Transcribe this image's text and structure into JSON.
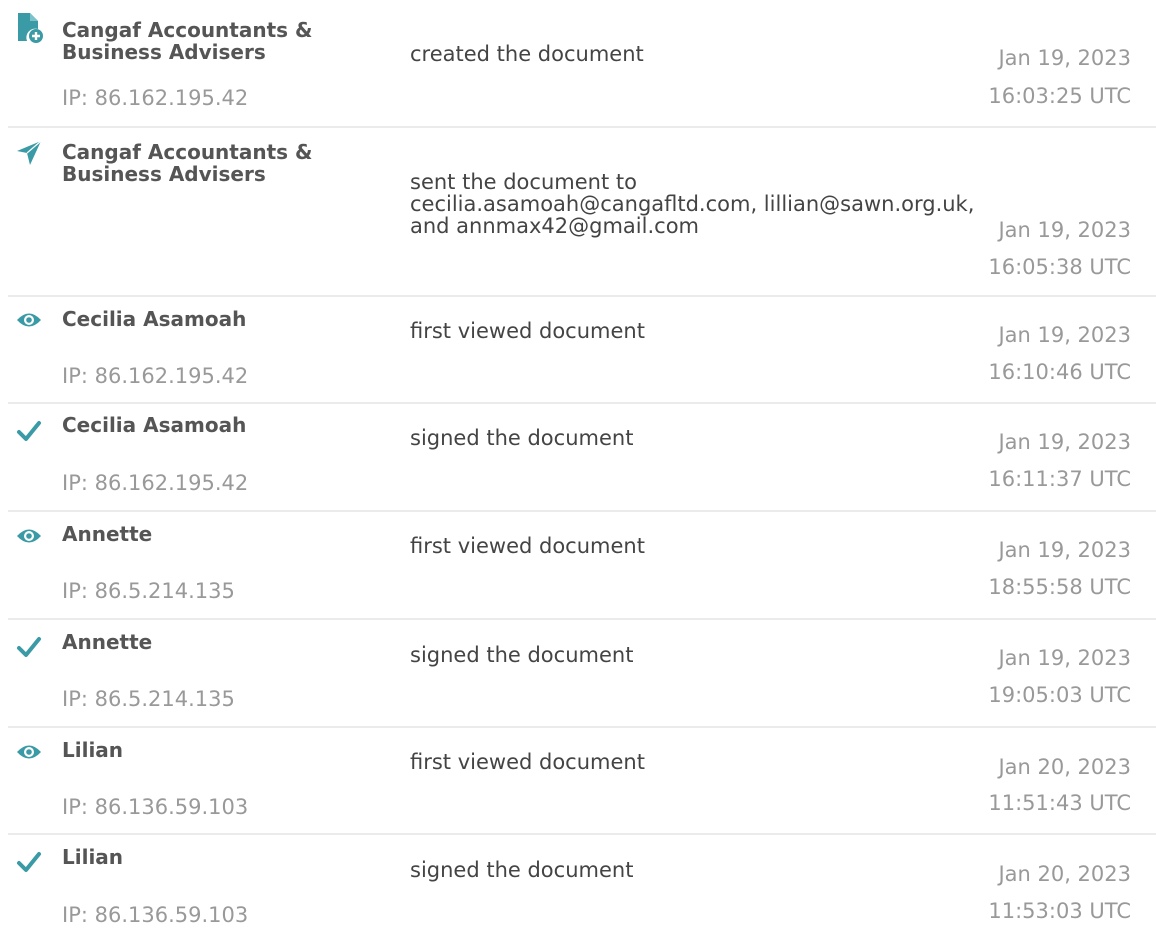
{
  "accent_color": "#3a9aa5",
  "events": [
    {
      "icon": "document-add-icon",
      "actor": "Cangaf Accountants &\nBusiness Advisers",
      "ip": "IP: 86.162.195.42",
      "action": "created the document",
      "date": "Jan 19, 2023",
      "time": "16:03:25 UTC"
    },
    {
      "icon": "paper-plane-icon",
      "actor": "Cangaf Accountants &\nBusiness Advisers",
      "ip": "",
      "action": "sent the document to\ncecilia.asamoah@cangafltd.com, lillian@sawn.org.uk,\nand annmax42@gmail.com",
      "date": "Jan 19, 2023",
      "time": "16:05:38 UTC"
    },
    {
      "icon": "eye-icon",
      "actor": "Cecilia Asamoah",
      "ip": "IP: 86.162.195.42",
      "action": "first viewed document",
      "date": "Jan 19, 2023",
      "time": "16:10:46 UTC"
    },
    {
      "icon": "checkmark-icon",
      "actor": "Cecilia Asamoah",
      "ip": "IP: 86.162.195.42",
      "action": "signed the document",
      "date": "Jan 19, 2023",
      "time": "16:11:37 UTC"
    },
    {
      "icon": "eye-icon",
      "actor": "Annette",
      "ip": "IP: 86.5.214.135",
      "action": "first viewed document",
      "date": "Jan 19, 2023",
      "time": "18:55:58 UTC"
    },
    {
      "icon": "checkmark-icon",
      "actor": "Annette",
      "ip": "IP: 86.5.214.135",
      "action": "signed the document",
      "date": "Jan 19, 2023",
      "time": "19:05:03 UTC"
    },
    {
      "icon": "eye-icon",
      "actor": "Lilian",
      "ip": "IP: 86.136.59.103",
      "action": "first viewed document",
      "date": "Jan 20, 2023",
      "time": "11:51:43 UTC"
    },
    {
      "icon": "checkmark-icon",
      "actor": "Lilian",
      "ip": "IP: 86.136.59.103",
      "action": "signed the document",
      "date": "Jan 20, 2023",
      "time": "11:53:03 UTC"
    }
  ]
}
